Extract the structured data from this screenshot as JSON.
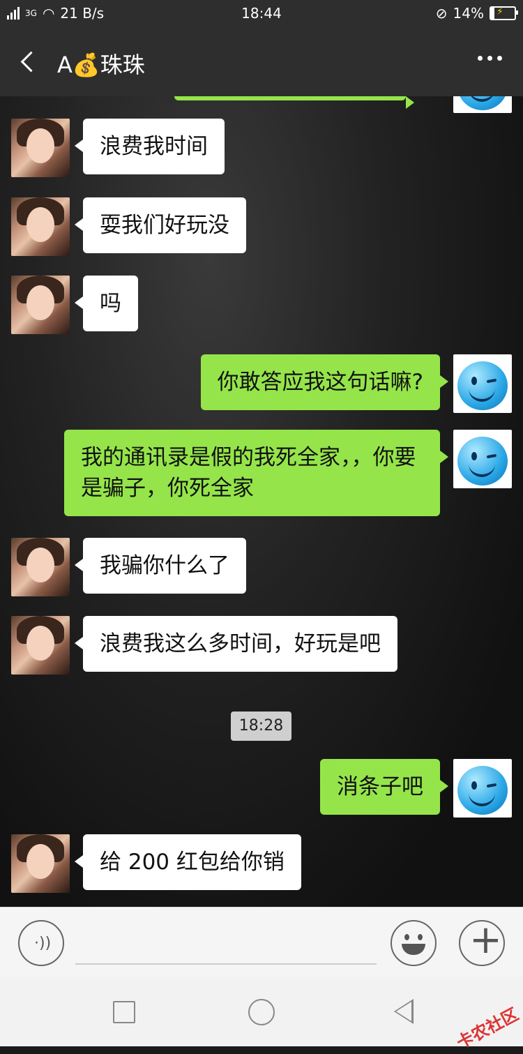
{
  "status_bar": {
    "network": "3G",
    "speed": "21 B/s",
    "time": "18:44",
    "battery": "14%"
  },
  "header": {
    "title": "A💰珠珠"
  },
  "messages": [
    {
      "side": "left",
      "text": "浪费我时间"
    },
    {
      "side": "left",
      "text": "耍我们好玩没"
    },
    {
      "side": "left",
      "text": "吗"
    },
    {
      "side": "right",
      "text": "你敢答应我这句话嘛?"
    },
    {
      "side": "right",
      "text": "我的通讯录是假的我死全家，，你要是骗子，你死全家"
    },
    {
      "side": "left",
      "text": "我骗你什么了"
    },
    {
      "side": "left",
      "text": "浪费我这么多时间，好玩是吧"
    },
    {
      "side": "right",
      "text": "消条子吧"
    },
    {
      "side": "left",
      "text": "给 200 红包给你销"
    }
  ],
  "timestamp": "18:28",
  "icons": {
    "back": "chevron-left-icon",
    "more": "more-dots-icon",
    "voice": "voice-icon",
    "emoji": "emoji-icon",
    "plus": "plus-icon"
  },
  "watermark": "卡农社区"
}
